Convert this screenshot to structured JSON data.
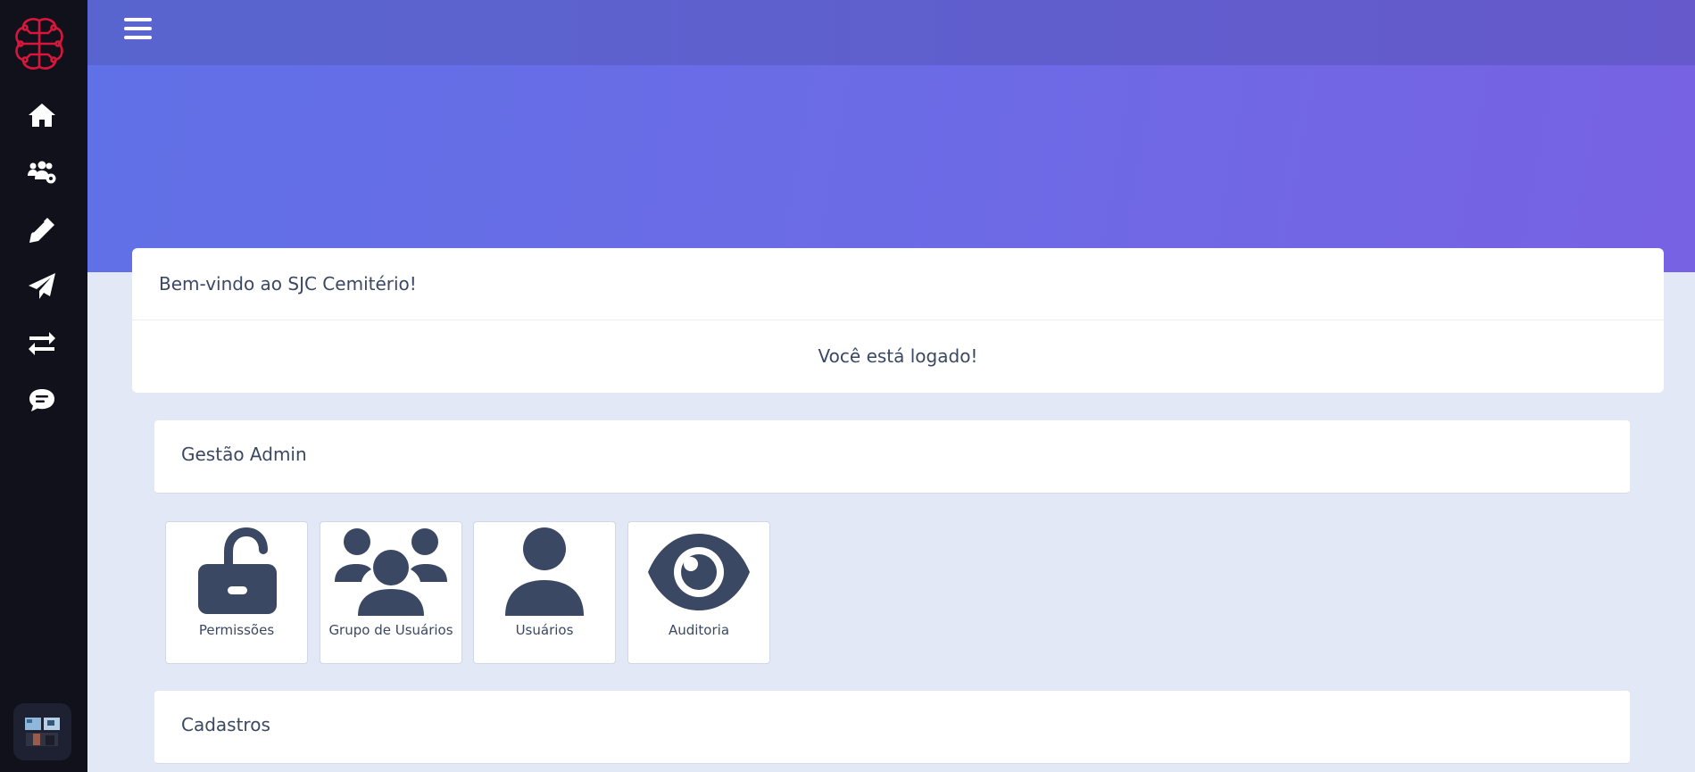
{
  "app": {
    "logo_icon": "brain-circuit-logo-icon",
    "accent_color": "#d8163c",
    "sidebar_bg": "#11111c",
    "header_gradient": [
      "#5965cf",
      "#6559cc"
    ],
    "hero_gradient": [
      "#6070e6",
      "#7762e3"
    ]
  },
  "sidebar": {
    "items": [
      {
        "icon": "home-icon"
      },
      {
        "icon": "users-gear-icon"
      },
      {
        "icon": "pen-icon"
      },
      {
        "icon": "paper-plane-icon"
      },
      {
        "icon": "exchange-arrows-icon"
      },
      {
        "icon": "comment-dots-icon"
      }
    ],
    "avatar_icon": "user-avatar-thumbnail"
  },
  "header": {
    "menu_icon": "hamburger-menu-icon"
  },
  "welcome": {
    "title": "Bem-vindo ao SJC Cemitério!",
    "message": "Você está logado!"
  },
  "admin_section": {
    "title": "Gestão Admin",
    "tiles": [
      {
        "label": "Permissões",
        "icon": "unlock-icon"
      },
      {
        "label": "Grupo de Usuários",
        "icon": "users-group-icon"
      },
      {
        "label": "Usuários",
        "icon": "user-icon"
      },
      {
        "label": "Auditoria",
        "icon": "eye-icon"
      }
    ]
  },
  "cadastros_section": {
    "title": "Cadastros"
  }
}
